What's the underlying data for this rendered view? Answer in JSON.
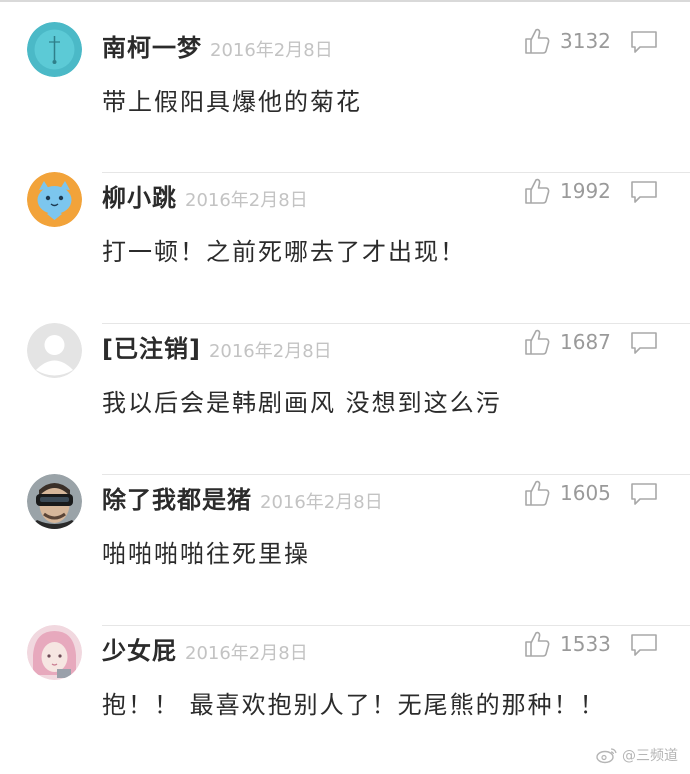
{
  "comments": [
    {
      "username": "南柯一梦",
      "date": "2016年2月8日",
      "text": "带上假阳具爆他的菊花",
      "likes": "3132",
      "avatar_icon": "teal-circle-avatar"
    },
    {
      "username": "柳小跳",
      "date": "2016年2月8日",
      "text": "打一顿！之前死哪去了才出现！",
      "likes": "1992",
      "avatar_icon": "blue-cat-on-orange-avatar"
    },
    {
      "username": "[已注销]",
      "date": "2016年2月8日",
      "text": "我以后会是韩剧画风 没想到这么污",
      "likes": "1687",
      "avatar_icon": "default-grey-avatar"
    },
    {
      "username": "除了我都是猪",
      "date": "2016年2月8日",
      "text": "啪啪啪啪往死里操",
      "likes": "1605",
      "avatar_icon": "man-with-vr-headset-avatar"
    },
    {
      "username": "少女屁",
      "date": "2016年2月8日",
      "text": "抱！！ 最喜欢抱别人了！无尾熊的那种！！",
      "likes": "1533",
      "avatar_icon": "pink-girl-avatar"
    }
  ],
  "watermark": {
    "text": "@三频道",
    "icon": "weibo-logo-icon"
  },
  "colors": {
    "username": "#2b2b2b",
    "date": "#c3c3c3",
    "like_count": "#9a9a9a",
    "divider": "#e6e6e6"
  }
}
